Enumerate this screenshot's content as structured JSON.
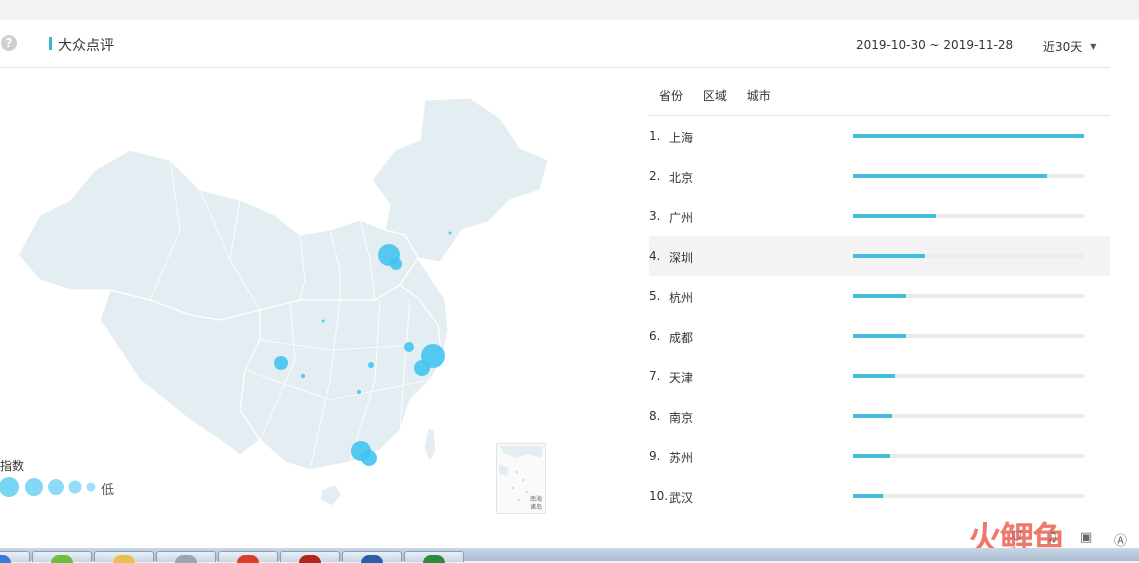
{
  "header": {
    "title": "大众点评",
    "help_icon": "question-circle-icon",
    "date_range": "2019-10-30 ~ 2019-11-28",
    "period": "近30天"
  },
  "map": {
    "legend_title": "指数",
    "legend_low": "低",
    "inset_label_1": "南海",
    "inset_label_2": "诸岛",
    "bubble_color": "#3fc3f0",
    "land_color": "#e6eff3"
  },
  "tabs": [
    "省份",
    "区域",
    "城市"
  ],
  "ranking": [
    {
      "rank": "1.",
      "name": "上海",
      "value": 1.0
    },
    {
      "rank": "2.",
      "name": "北京",
      "value": 0.84
    },
    {
      "rank": "3.",
      "name": "广州",
      "value": 0.36
    },
    {
      "rank": "4.",
      "name": "深圳",
      "value": 0.31
    },
    {
      "rank": "5.",
      "name": "杭州",
      "value": 0.23
    },
    {
      "rank": "6.",
      "name": "成都",
      "value": 0.23
    },
    {
      "rank": "7.",
      "name": "天津",
      "value": 0.18
    },
    {
      "rank": "8.",
      "name": "南京",
      "value": 0.17
    },
    {
      "rank": "9.",
      "name": "苏州",
      "value": 0.16
    },
    {
      "rank": "10.",
      "name": "武汉",
      "value": 0.13
    }
  ],
  "watermark": {
    "line": "火鲤鱼"
  },
  "colors": {
    "accent": "#3bb5d6",
    "bar": "#3fbfdc",
    "track": "#ececec"
  }
}
